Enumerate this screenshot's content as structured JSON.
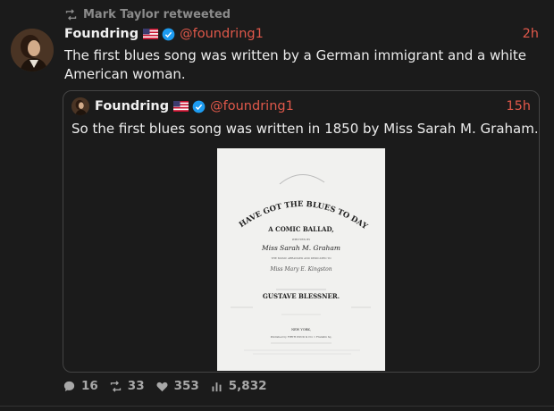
{
  "retweet": {
    "text": "Mark Taylor retweeted",
    "icon": "retweet-icon"
  },
  "tweet": {
    "author_name": "Foundring",
    "flag": "🇺🇸",
    "handle": "@foundring1",
    "time": "2h",
    "text": "The first blues song was written by a German immigrant and a white American woman."
  },
  "quote": {
    "author_name": "Foundring",
    "flag": "🇺🇸",
    "handle": "@foundring1",
    "time": "15h",
    "text": "So the first blues song was written in 1850 by Miss Sarah M. Graham.",
    "image": {
      "title": "I HAVE GOT THE BLUES TO DAY!",
      "subtitle": "A COMIC BALLAD,",
      "written_by": "WRITTEN BY",
      "author": "Miss Sarah M. Graham",
      "line2": "THE MUSIC ARRANGED AND DEDICATED TO",
      "dedicatee": "Miss Mary E. Kingston",
      "composer": "GUSTAVE BLESSNER.",
      "city": "NEW YORK,",
      "publisher": "Published by FIRTH POND & CO. 1 Franklin Sq."
    }
  },
  "actions": {
    "replies": "16",
    "retweets": "33",
    "likes": "353",
    "views": "5,832"
  },
  "colors": {
    "accent": "#e0584a",
    "verified": "#1d9bf0",
    "background": "#1b1b1b"
  }
}
